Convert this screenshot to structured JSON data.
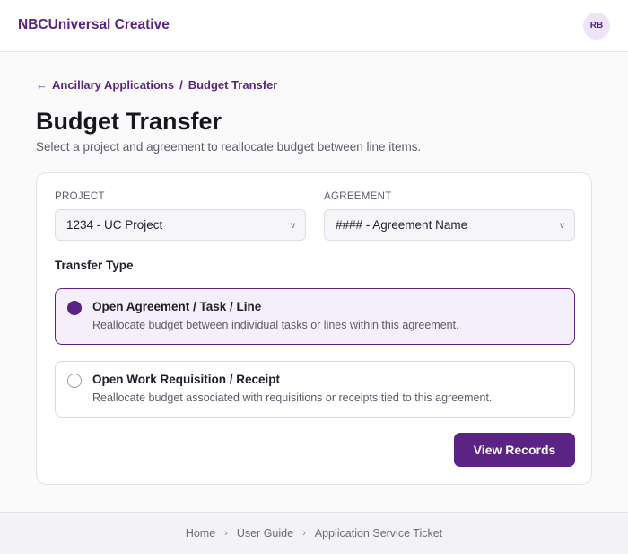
{
  "header": {
    "brand": "NBCUniversal Creative",
    "avatar_initials": "RB"
  },
  "breadcrumb": {
    "back_icon": "arrow-left-icon",
    "parent": "Ancillary Applications",
    "separator": "/",
    "current": "Budget Transfer"
  },
  "page": {
    "title": "Budget Transfer",
    "subtitle": "Select a project and agreement to reallocate budget between line items."
  },
  "form": {
    "project_label": "PROJECT",
    "project_value": "1234 - UC Project",
    "agreement_label": "AGREEMENT",
    "agreement_value": "#### - Agreement Name",
    "chevron_icon": "chevron-down-icon",
    "transfer_type_label": "Transfer Type",
    "options": [
      {
        "title": "Open Agreement / Task / Line",
        "description": "Reallocate budget between individual tasks or lines within this agreement.",
        "selected": true
      },
      {
        "title": "Open Work Requisition / Receipt",
        "description": "Reallocate budget associated with requisitions or receipts tied to this agreement.",
        "selected": false
      }
    ],
    "submit_label": "View Records"
  },
  "footer": {
    "links": [
      "Home",
      "User Guide",
      "Application Service Ticket"
    ],
    "separator": "›"
  },
  "colors": {
    "accent": "#5b2383",
    "selected_bg": "#f5eefb"
  }
}
